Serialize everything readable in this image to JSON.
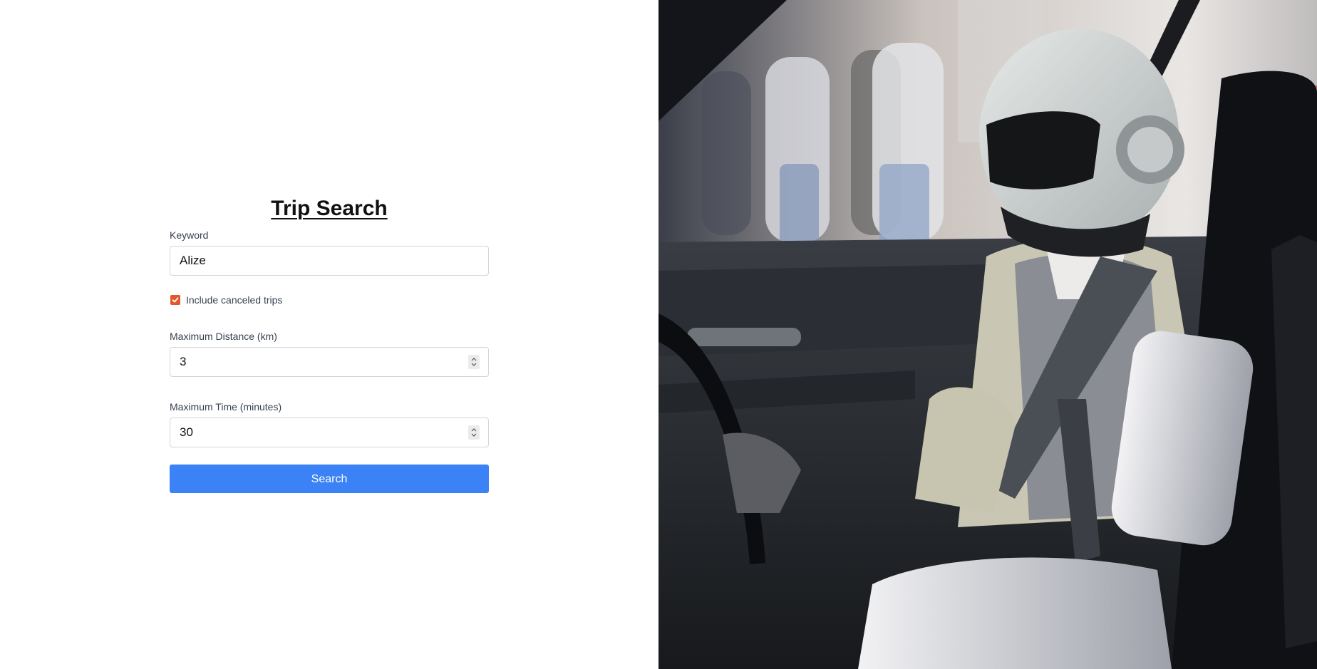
{
  "form": {
    "title": "Trip Search",
    "keyword": {
      "label": "Keyword",
      "value": "Alize"
    },
    "include_canceled": {
      "label": "Include canceled trips",
      "checked": true
    },
    "max_distance": {
      "label": "Maximum Distance (km)",
      "value": "3"
    },
    "max_time": {
      "label": "Maximum Time (minutes)",
      "value": "30"
    },
    "search_label": "Search"
  },
  "colors": {
    "accent": "#3b82f6",
    "checkbox": "#e2572b"
  },
  "image": {
    "subject": "robot-driver-in-car-photo"
  }
}
